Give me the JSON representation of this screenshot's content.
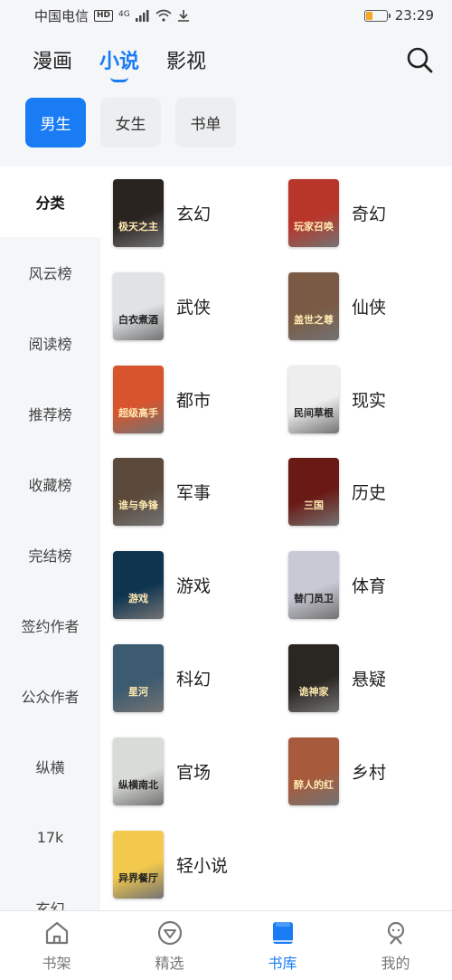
{
  "status_bar": {
    "carrier": "中国电信",
    "hd": "HD",
    "network": "4G",
    "time": "23:29",
    "battery_level": 0.3
  },
  "tabs": [
    {
      "label": "漫画"
    },
    {
      "label": "小说"
    },
    {
      "label": "影视"
    }
  ],
  "active_tab": "小说",
  "chips": [
    {
      "label": "男生"
    },
    {
      "label": "女生"
    },
    {
      "label": "书单"
    }
  ],
  "sidebar": [
    {
      "label": "分类"
    },
    {
      "label": "风云榜"
    },
    {
      "label": "阅读榜"
    },
    {
      "label": "推荐榜"
    },
    {
      "label": "收藏榜"
    },
    {
      "label": "完结榜"
    },
    {
      "label": "签约作者"
    },
    {
      "label": "公众作者"
    },
    {
      "label": "纵横"
    },
    {
      "label": "17k"
    },
    {
      "label": "玄幻"
    }
  ],
  "categories": [
    {
      "label": "玄幻",
      "cover_title": "极天之主",
      "cover_color": "#2a2420"
    },
    {
      "label": "奇幻",
      "cover_title": "玩家召唤",
      "cover_color": "#b8352a"
    },
    {
      "label": "武侠",
      "cover_title": "白衣煮酒",
      "cover_color": "#dfe3e6"
    },
    {
      "label": "仙侠",
      "cover_title": "盖世之尊",
      "cover_color": "#7a5a44"
    },
    {
      "label": "都市",
      "cover_title": "超级高手",
      "cover_color": "#d8542c"
    },
    {
      "label": "现实",
      "cover_title": "民间草根",
      "cover_color": "#eeeeee"
    },
    {
      "label": "军事",
      "cover_title": "谁与争锋",
      "cover_color": "#5b4a3c"
    },
    {
      "label": "历史",
      "cover_title": "三国",
      "cover_color": "#6a1a14"
    },
    {
      "label": "游戏",
      "cover_title": "游戏",
      "cover_color": "#0e3450"
    },
    {
      "label": "体育",
      "cover_title": "替门员卫",
      "cover_color": "#c9c9d6"
    },
    {
      "label": "科幻",
      "cover_title": "星河",
      "cover_color": "#3c5a70"
    },
    {
      "label": "悬疑",
      "cover_title": "诡神家",
      "cover_color": "#2a2622"
    },
    {
      "label": "官场",
      "cover_title": "纵横南北",
      "cover_color": "#d9dcd6"
    },
    {
      "label": "乡村",
      "cover_title": "醉人的红",
      "cover_color": "#a85a3c"
    },
    {
      "label": "轻小说",
      "cover_title": "异界餐厅",
      "cover_color": "#f2c94c"
    }
  ],
  "bottom_nav": [
    {
      "label": "书架",
      "icon": "home-icon"
    },
    {
      "label": "精选",
      "icon": "compass-icon"
    },
    {
      "label": "书库",
      "icon": "book-icon"
    },
    {
      "label": "我的",
      "icon": "profile-icon"
    }
  ],
  "active_nav": "书库",
  "colors": {
    "accent": "#1a7cf5",
    "header_bg": "#f4f6f8"
  }
}
